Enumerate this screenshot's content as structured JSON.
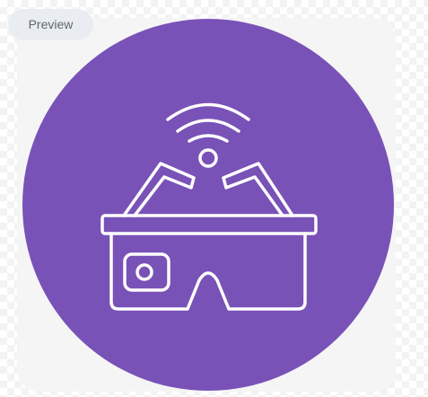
{
  "toolbar": {
    "preview_label": "Preview"
  },
  "image": {
    "icon": "smart-glasses-wifi-icon",
    "background_color": "#7952b7",
    "line_color": "#ffffff"
  }
}
